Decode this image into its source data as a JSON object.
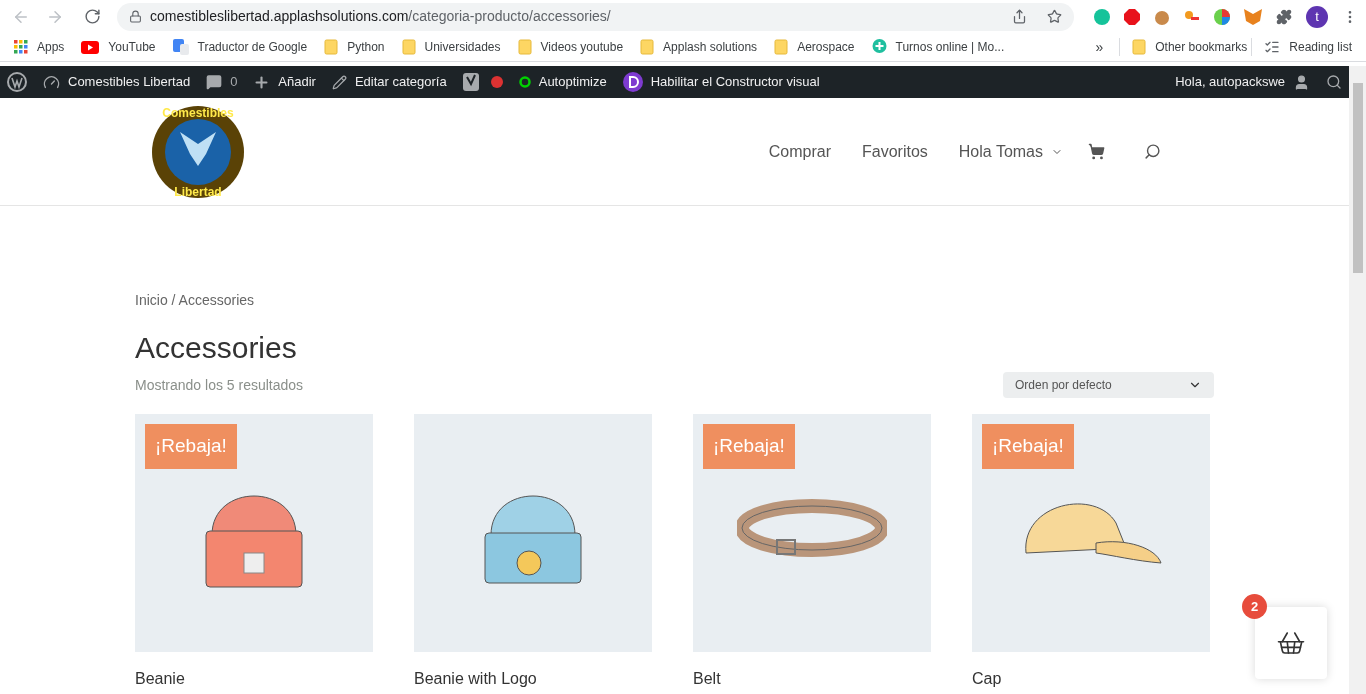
{
  "browser": {
    "url_host": "comestibleslibertad.applashsolutions.com",
    "url_path": "/categoria-producto/accessories/",
    "profile_initial": "t"
  },
  "bookmarks": [
    {
      "label": "Apps",
      "kind": "apps"
    },
    {
      "label": "YouTube",
      "kind": "youtube"
    },
    {
      "label": "Traductor de Google",
      "kind": "translate"
    },
    {
      "label": "Python",
      "kind": "folder"
    },
    {
      "label": "Universidades",
      "kind": "folder"
    },
    {
      "label": "Videos youtube",
      "kind": "folder"
    },
    {
      "label": "Applash solutions",
      "kind": "folder"
    },
    {
      "label": "Aerospace",
      "kind": "folder"
    },
    {
      "label": "Turnos online | Mo...",
      "kind": "pin"
    }
  ],
  "bookmarks_more": "»",
  "bookmarks_right": [
    {
      "label": "Other bookmarks",
      "kind": "folder"
    },
    {
      "label": "Reading list",
      "kind": "reading"
    }
  ],
  "admin_bar": {
    "items": [
      {
        "label": "Comestibles Libertad",
        "kind": "dashboard"
      },
      {
        "label": "0",
        "kind": "comments"
      },
      {
        "label": "Añadir",
        "kind": "add"
      },
      {
        "label": "Editar categoría",
        "kind": "edit"
      },
      {
        "kind": "yoast"
      },
      {
        "label": "Autoptimize",
        "kind": "autoptimize"
      },
      {
        "label": "Habilitar el Constructor visual",
        "kind": "divi"
      }
    ],
    "greeting": "Hola, autopackswe"
  },
  "site": {
    "logo_lines": [
      "Comestibles",
      "Libertad"
    ],
    "nav": [
      {
        "label": "Comprar",
        "has_caret": false
      },
      {
        "label": "Favoritos",
        "has_caret": false
      },
      {
        "label": "Hola Tomas",
        "has_caret": true
      }
    ]
  },
  "breadcrumb": "Inicio / Accessories",
  "title": "Accessories",
  "result_count": "Mostrando los 5 resultados",
  "sort": {
    "value": "Orden por defecto"
  },
  "products": [
    {
      "name": "Beanie",
      "sale_badge": "¡Rebaja!",
      "kind": "beanie"
    },
    {
      "name": "Beanie with Logo",
      "kind": "beanie_logo"
    },
    {
      "name": "Belt",
      "sale_badge": "¡Rebaja!",
      "kind": "belt"
    },
    {
      "name": "Cap",
      "sale_badge": "¡Rebaja!",
      "kind": "cap"
    }
  ],
  "cart_widget": {
    "count": "2"
  }
}
